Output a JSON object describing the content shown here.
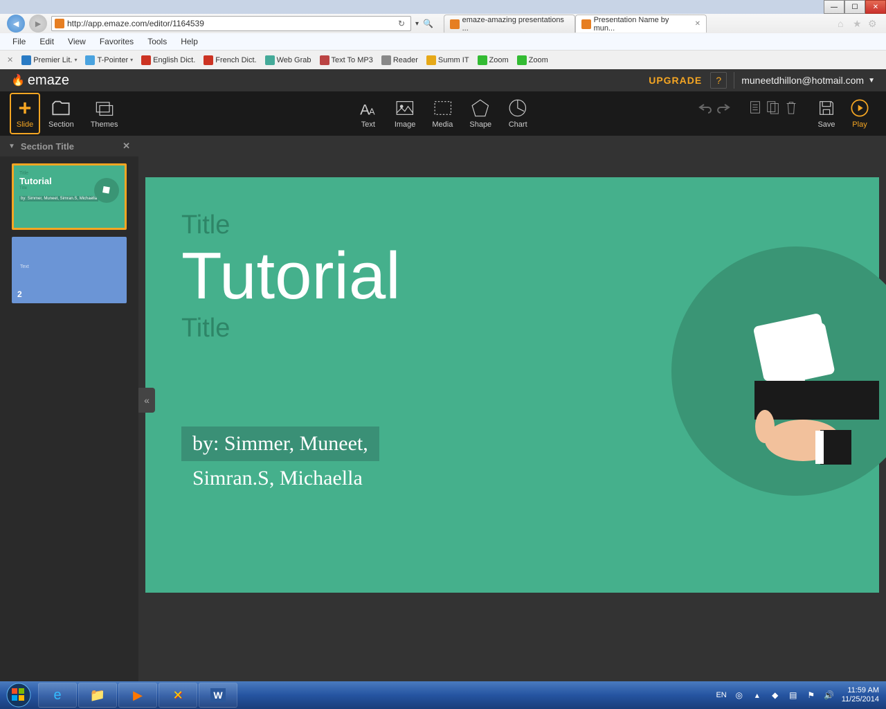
{
  "window": {
    "min": "—",
    "max": "☐"
  },
  "nav": {
    "url": "http://app.emaze.com/editor/1164539"
  },
  "tabs": [
    {
      "label": "emaze-amazing presentations ..."
    },
    {
      "label": "Presentation Name by mun..."
    }
  ],
  "menu": [
    "File",
    "Edit",
    "View",
    "Favorites",
    "Tools",
    "Help"
  ],
  "bookmarks": [
    {
      "label": "Premier Lit.",
      "color": "#2a7bc4"
    },
    {
      "label": "T-Pointer",
      "color": "#4aa3df"
    },
    {
      "label": "English Dict.",
      "color": "#c32"
    },
    {
      "label": "French Dict.",
      "color": "#c32"
    },
    {
      "label": "Web Grab",
      "color": "#4a9"
    },
    {
      "label": "Text To MP3",
      "color": "#b44"
    },
    {
      "label": "Reader",
      "color": "#888"
    },
    {
      "label": "Summ IT",
      "color": "#e6a817"
    },
    {
      "label": "Zoom",
      "color": "#3b3"
    },
    {
      "label": "Zoom",
      "color": "#3b3"
    }
  ],
  "emaze": {
    "logo": "emaze",
    "upgrade": "UPGRADE",
    "help": "?",
    "user": "muneetdhillon@hotmail.com",
    "toolbar_left": [
      {
        "label": "Slide"
      },
      {
        "label": "Section"
      },
      {
        "label": "Themes"
      }
    ],
    "toolbar_center": [
      {
        "label": "Text"
      },
      {
        "label": "Image"
      },
      {
        "label": "Media"
      },
      {
        "label": "Shape"
      },
      {
        "label": "Chart"
      }
    ],
    "toolbar_right": [
      {
        "label": "Save"
      },
      {
        "label": "Play"
      }
    ]
  },
  "left_panel": {
    "section": "Section Title",
    "slide2_text": "Text",
    "slide2_num": "2",
    "t1": "Title",
    "t2": "Tutorial",
    "t3": "Title",
    "tby": "by: Simmer, Muneet, Simran.S, Michaella"
  },
  "slide": {
    "title1": "Title",
    "title2": "Tutorial",
    "title3": "Title",
    "by1": "by: Simmer, Muneet,",
    "by2": "Simran.S, Michaella"
  },
  "systray": {
    "lang": "EN",
    "time": "11:59 AM",
    "date": "11/25/2014"
  }
}
